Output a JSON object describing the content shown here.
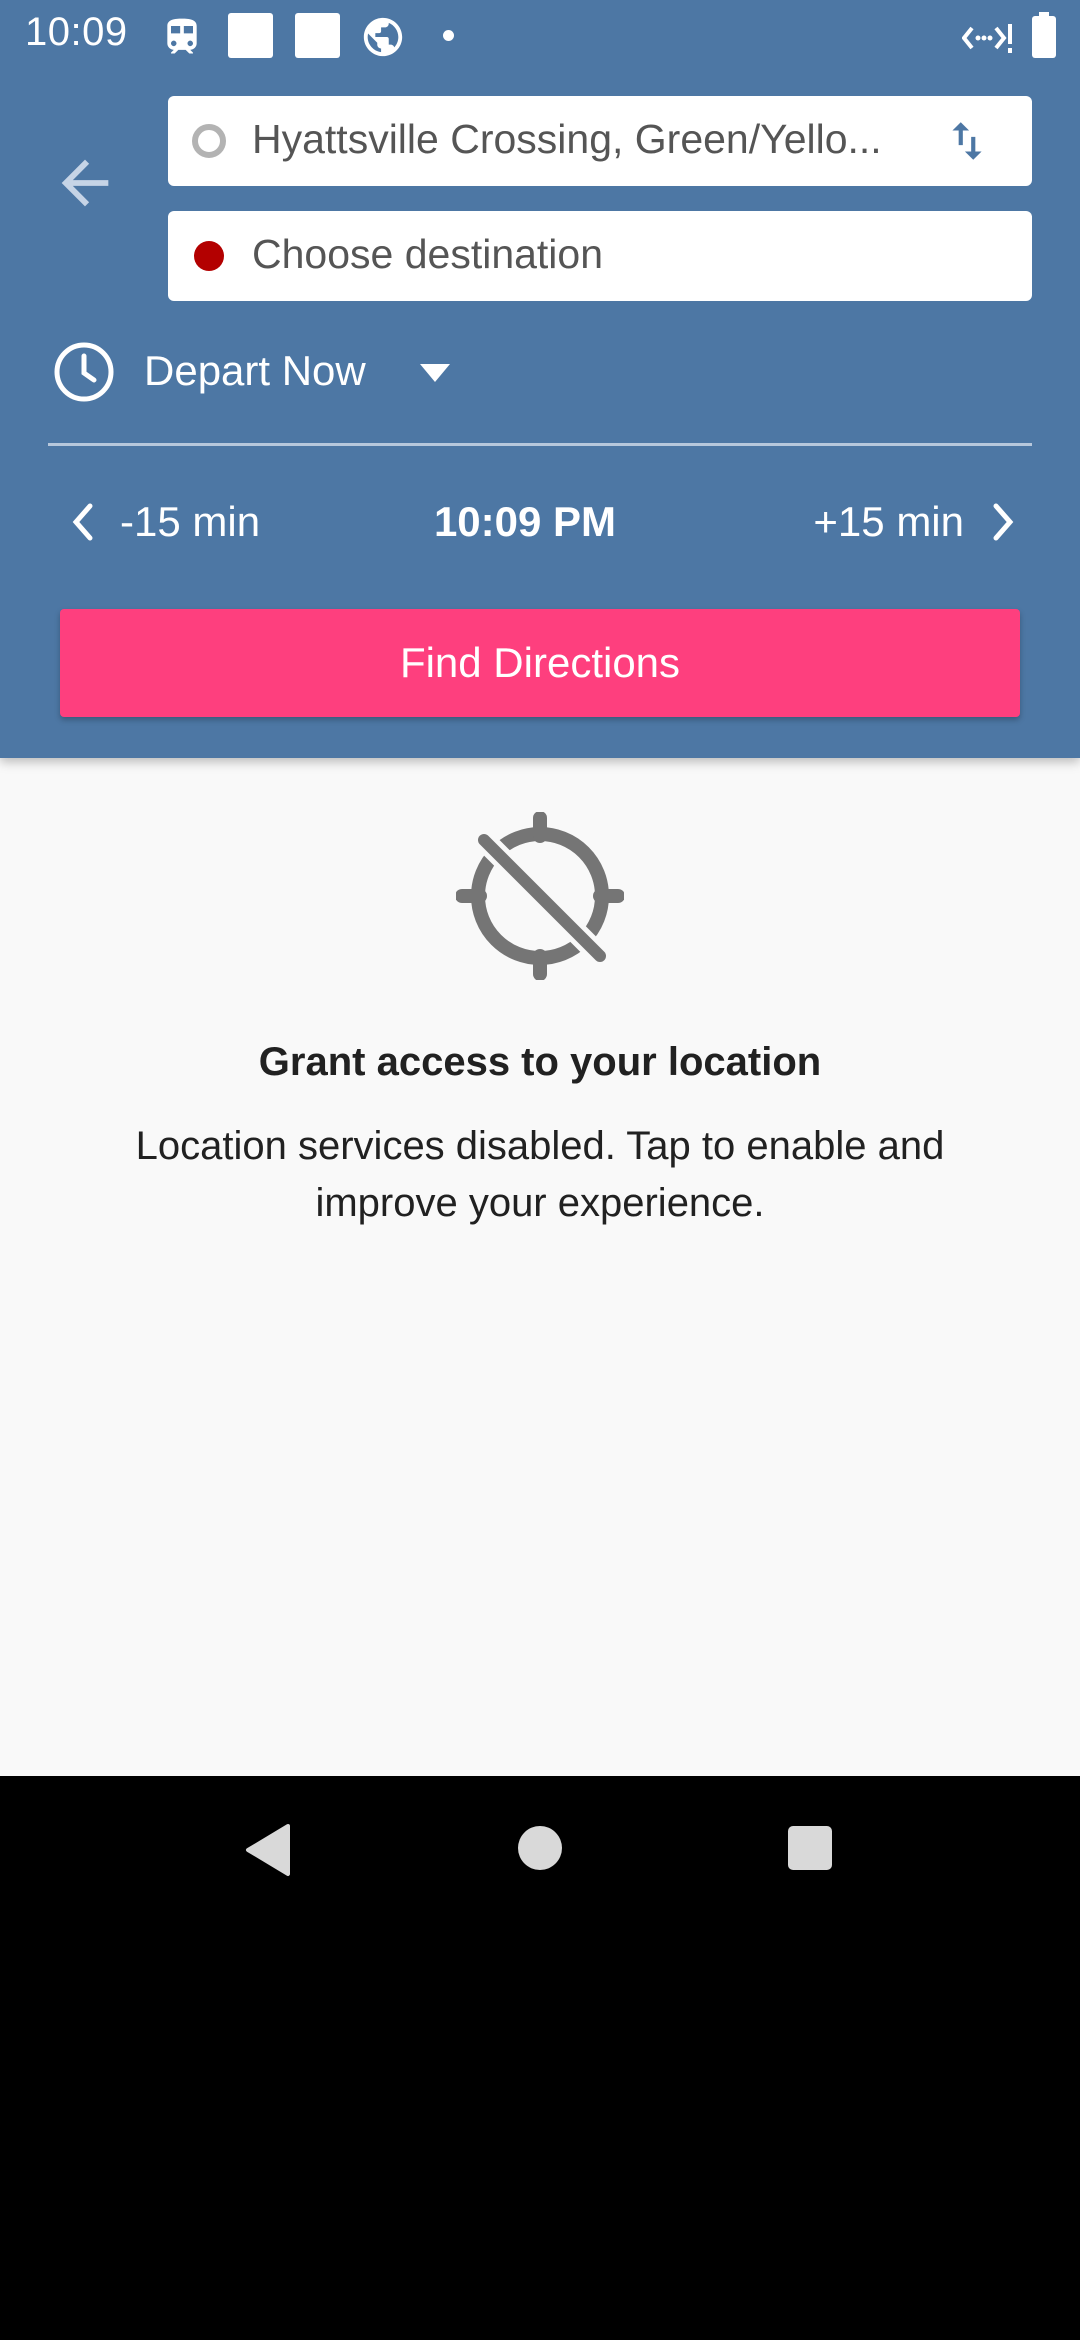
{
  "status_bar": {
    "time": "10:09",
    "icons": [
      "tram-icon",
      "notification-square-icon",
      "notification-square-icon",
      "globe-icon",
      "dot-icon",
      "network-icon",
      "battery-icon"
    ]
  },
  "header": {
    "origin": {
      "value": "Hyattsville Crossing, Green/Yello..."
    },
    "destination": {
      "placeholder": "Choose destination"
    },
    "depart": {
      "label": "Depart Now"
    },
    "time_row": {
      "prev_label": "-15 min",
      "current_time": "10:09 PM",
      "next_label": "+15 min"
    },
    "find_button_label": "Find Directions"
  },
  "location_prompt": {
    "title": "Grant access to your location",
    "description": "Location services disabled. Tap to enable and improve your experience."
  },
  "colors": {
    "header_bg": "#4d77a4",
    "accent_button": "#fe3f7e",
    "destination_dot": "#b30000",
    "content_bg": "#f9f9f9"
  }
}
